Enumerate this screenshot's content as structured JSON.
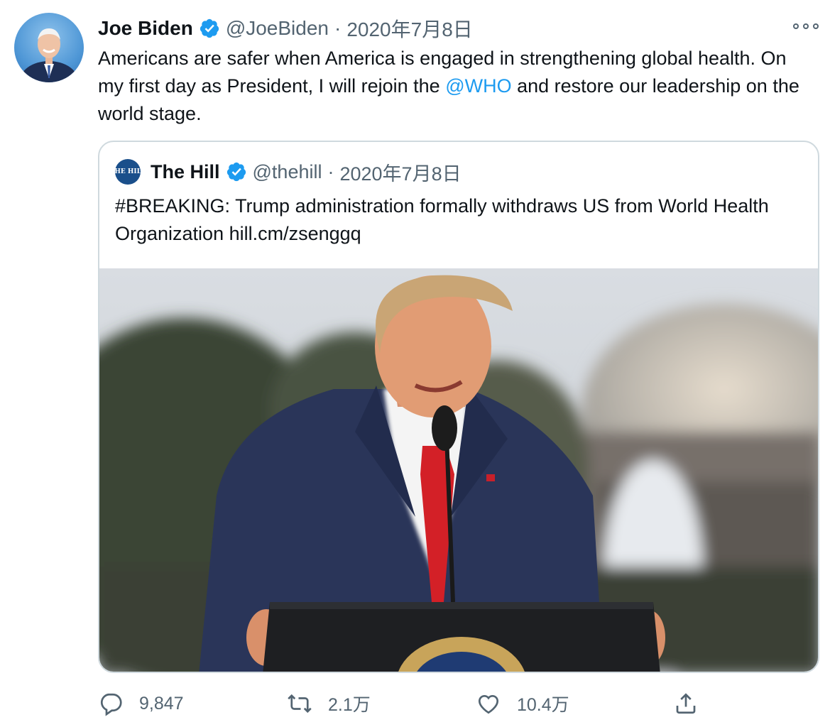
{
  "author": {
    "name": "Joe Biden",
    "handle": "@JoeBiden",
    "date": "2020年7月8日",
    "separator": "·"
  },
  "tweet": {
    "text_before_link": "Americans are safer when America is engaged in strengthening global health. On my first day as President, I will rejoin the ",
    "mention": "@WHO",
    "text_after_link": " and restore our leadership on the world stage."
  },
  "quote": {
    "logo_text": "THE HILL",
    "name": "The Hill",
    "handle": "@thehill",
    "date": "2020年7月8日",
    "separator": "·",
    "text": "#BREAKING: Trump administration formally withdraws US from World Health Organization hill.cm/zsenggq"
  },
  "actions": {
    "replies": "9,847",
    "retweets": "2.1万",
    "likes": "10.4万"
  },
  "icons": {
    "verified": "verified-badge-icon",
    "more": "more-options-icon",
    "reply": "reply-icon",
    "retweet": "retweet-icon",
    "like": "heart-icon",
    "share": "share-icon"
  },
  "colors": {
    "accent": "#1d9bf0",
    "muted": "#536471",
    "border": "#cfd9de"
  }
}
